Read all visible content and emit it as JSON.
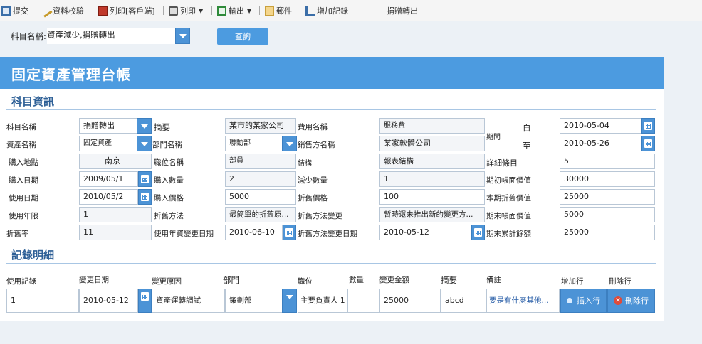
{
  "toolbar": {
    "submit": "提交",
    "validate": "資料校驗",
    "print_customer": "列印[客戶端]",
    "print": "列印",
    "export": "輸出",
    "mail": "郵件",
    "add_record": "增加記錄",
    "title": "捐贈轉出"
  },
  "search": {
    "label": "科目名稱:",
    "value": "資產減少,捐贈轉出",
    "query_button": "查詢"
  },
  "banner": {
    "title": "固定資產管理台帳"
  },
  "subject_section": {
    "title": "科目資訊",
    "labels": {
      "subject_name": "科目名稱",
      "asset_name": "資產名稱",
      "purchase_place": "購入地點",
      "purchase_date": "購入日期",
      "use_date": "使用日期",
      "use_years": "使用年限",
      "depreciation_rate": "折舊率",
      "summary": "摘要",
      "department": "部門名稱",
      "position": "職位名稱",
      "purchase_qty": "購入數量",
      "purchase_price": "購入價格",
      "depreciation_method": "折舊方法",
      "use_years_change_date": "使用年資變更日期",
      "expense_name": "費用名稱",
      "seller_name": "銷售方名稱",
      "structure": "結構",
      "decrease_qty": "減少數量",
      "depreciation_price": "折舊價格",
      "method_change": "折舊方法變更",
      "method_change_date": "折舊方法變更日期",
      "period": "期間",
      "from": "自",
      "to": "至",
      "detail_items": "詳細條目",
      "opening_book_value": "期初帳面價值",
      "current_depreciation": "本期折舊價值",
      "closing_book_value": "期末帳面價值",
      "closing_accumulated": "期末累計餘額"
    },
    "values": {
      "subject_name": "捐贈轉出",
      "asset_name": "固定資產",
      "purchase_place": "南京",
      "purchase_date": "2009/05/1",
      "use_date": "2010/05/2",
      "use_years": "1",
      "depreciation_rate": "11",
      "summary": "某市的某家公司",
      "department": "聯動部",
      "position": "部員",
      "purchase_qty": "2",
      "purchase_price": "5000",
      "depreciation_method": "最簡單的折舊原...",
      "use_years_change_date": "2010-06-10",
      "expense_name": "服務費",
      "seller_name": "某家軟體公司",
      "structure": "報表結構",
      "decrease_qty": "1",
      "depreciation_price": "100",
      "method_change": "暫時還未推出新的變更方...",
      "method_change_date": "2010-05-12",
      "from": "2010-05-04",
      "to": "2010-05-26",
      "detail_items": "5",
      "opening_book_value": "30000",
      "current_depreciation": "25000",
      "closing_book_value": "5000",
      "closing_accumulated": "25000"
    }
  },
  "records_section": {
    "title": "記錄明細",
    "headers": [
      "使用記錄",
      "變更日期",
      "變更原因",
      "部門",
      "職位",
      "數量",
      "變更金額",
      "摘要",
      "備註",
      "增加行",
      "刪除行"
    ],
    "row": {
      "use_record": "1",
      "change_date": "2010-05-12",
      "change_reason": "資產運轉調試",
      "department": "策劃部",
      "position": "主要負責人 1",
      "quantity": "",
      "change_amount": "25000",
      "summary": "abcd",
      "remark": "要是有什麼其他...",
      "insert_button": "插入行",
      "delete_button": "刪除行"
    }
  }
}
